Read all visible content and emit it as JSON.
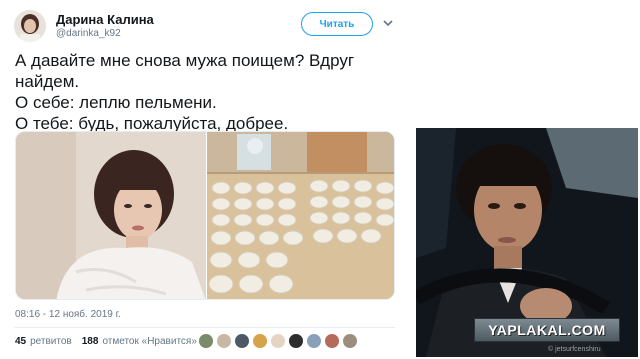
{
  "tweet": {
    "author_name": "Дарина Калина",
    "author_handle": "@darinka_k92",
    "follow_label": "Читать",
    "text_lines": [
      "А давайте мне снова мужа поищем? Вдруг",
      "найдем.",
      "О себе: леплю пельмени.",
      "О тебе: будь, пожалуйста, добрее."
    ],
    "timestamp": "08:16 - 12 нояб. 2019 г.",
    "retweets_count": "45",
    "retweets_label": "ретвитов",
    "likes_count": "188",
    "likes_label": "отметок «Нравится»"
  },
  "overlay": {
    "watermark": "YAPLAKAL.COM",
    "credit": "© jetsurfcenshiru"
  },
  "colors": {
    "accent": "#1da1f2",
    "text": "#14171a",
    "muted": "#657786",
    "border": "#e6ecf0"
  }
}
